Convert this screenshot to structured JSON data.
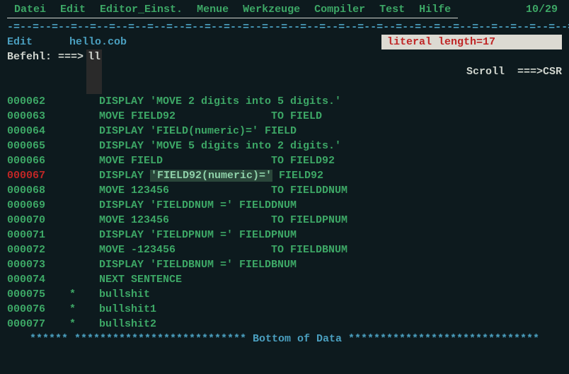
{
  "menu": {
    "items": [
      "Datei",
      "Edit",
      "Editor_Einst.",
      "Menue",
      "Werkzeuge",
      "Compiler",
      "Test",
      "Hilfe"
    ],
    "counter": "10/29"
  },
  "separator": "-=--=--=--=--=--=--=--=--=--=--=--=--=--=--=--=--=--=--=--=--=--=--=--=--=--=--=--=--=--=",
  "title": {
    "mode": "Edit",
    "file": "hello.cob",
    "message": "literal length=17"
  },
  "cmd": {
    "label": "Befehl: ===>",
    "value": "ll",
    "scroll_label": "Scroll  ===>",
    "scroll_value": "CSR"
  },
  "lines": [
    {
      "num": "000062",
      "active": false,
      "star": "",
      "code": "DISPLAY 'MOVE 2 digits into 5 digits.'"
    },
    {
      "num": "000063",
      "active": false,
      "star": "",
      "code": "MOVE FIELD92               TO FIELD"
    },
    {
      "num": "000064",
      "active": false,
      "star": "",
      "code": "DISPLAY 'FIELD(numeric)=' FIELD"
    },
    {
      "num": "000065",
      "active": false,
      "star": "",
      "code": "DISPLAY 'MOVE 5 digits into 2 digits.'"
    },
    {
      "num": "000066",
      "active": false,
      "star": "",
      "code": "MOVE FIELD                 TO FIELD92"
    },
    {
      "num": "000067",
      "active": true,
      "star": "",
      "code_pre": "DISPLAY ",
      "code_hl": "'FIELD92(numeric)='",
      "code_post": " FIELD92"
    },
    {
      "num": "000068",
      "active": false,
      "star": "",
      "code": "MOVE 123456                TO FIELDDNUM"
    },
    {
      "num": "000069",
      "active": false,
      "star": "",
      "code": "DISPLAY 'FIELDDNUM =' FIELDDNUM"
    },
    {
      "num": "000070",
      "active": false,
      "star": "",
      "code": "MOVE 123456                TO FIELDPNUM"
    },
    {
      "num": "000071",
      "active": false,
      "star": "",
      "code": "DISPLAY 'FIELDPNUM =' FIELDPNUM"
    },
    {
      "num": "000072",
      "active": false,
      "star": "",
      "code": "MOVE -123456               TO FIELDBNUM"
    },
    {
      "num": "000073",
      "active": false,
      "star": "",
      "code": "DISPLAY 'FIELDBNUM =' FIELDBNUM"
    },
    {
      "num": "000074",
      "active": false,
      "star": "",
      "code": "NEXT SENTENCE"
    },
    {
      "num": "000075",
      "active": false,
      "star": "*",
      "code": "bullshit"
    },
    {
      "num": "000076",
      "active": false,
      "star": "*",
      "code": "bullshit1"
    },
    {
      "num": "000077",
      "active": false,
      "star": "*",
      "code": "bullshit2"
    }
  ],
  "bottom": "****** *************************** Bottom of Data ******************************"
}
